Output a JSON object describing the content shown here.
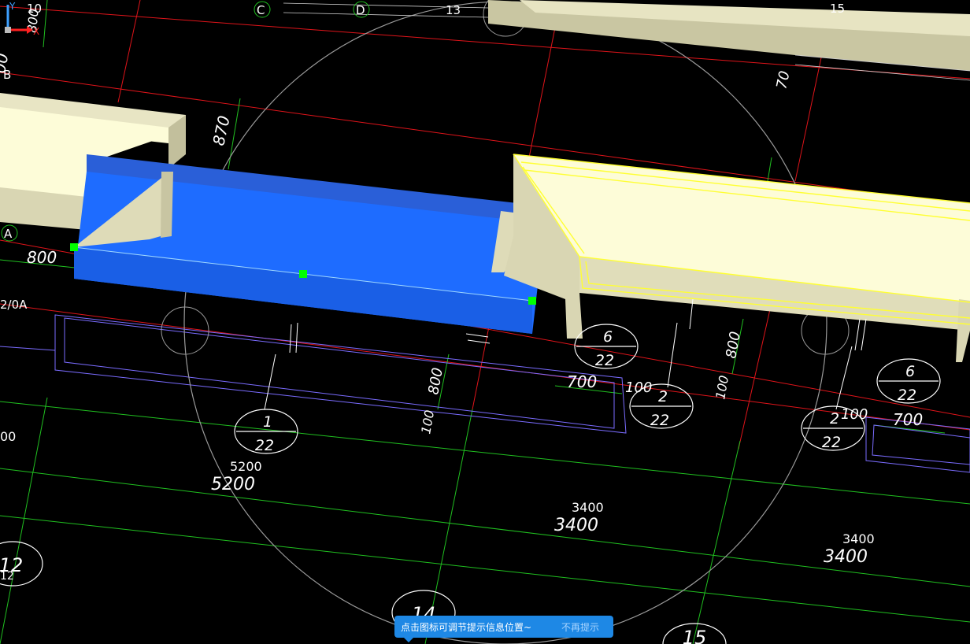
{
  "axis_labels": {
    "c": "C",
    "d": "D",
    "b": "B",
    "a": "A",
    "b_sub": "2/0A",
    "n10": "10",
    "n13": "13",
    "n15": "15"
  },
  "dimensions": {
    "d800_top_left": "800",
    "d00_top_left": "00",
    "d870": "870",
    "d70_top": "70",
    "d800_left": "800",
    "d800_mid": "800",
    "d100_mid": "100",
    "d700_right": "700",
    "d100_right": "100",
    "d800_right": "800",
    "d100_right2": "100",
    "d100_far": "100",
    "d700_far": "700",
    "d5200_a": "5200",
    "d5200_b": "5200",
    "d3400_a": "3400",
    "d3400_b": "3400",
    "d3400_c": "3400",
    "d3400_d": "3400",
    "d00_left": "00"
  },
  "section_marks": [
    {
      "top": "1",
      "bottom": "22"
    },
    {
      "top": "6",
      "bottom": "22"
    },
    {
      "top": "2",
      "bottom": "22"
    },
    {
      "top": "6",
      "bottom": "22"
    },
    {
      "top": "2",
      "bottom": "22"
    }
  ],
  "grid_circles": {
    "c12": "12",
    "c12_sub": "12",
    "c14": "14",
    "c15": "15"
  },
  "ucs": {
    "x": "X",
    "y": "Y"
  },
  "tooltip": {
    "message": "点击图标可调节提示信息位置~",
    "dismiss": "不再提示"
  },
  "colors": {
    "background": "#000000",
    "axis_line": "#e0141a",
    "dim_line": "#20c020",
    "selected_beam": "#1e6cff",
    "beam_fill": "#fdfcd8",
    "beam_side": "#d9d6b3",
    "highlight": "#ffff33",
    "outline": "#7a6cff",
    "tooltip_bg": "#1e88e5",
    "grip": "#00ff00"
  }
}
